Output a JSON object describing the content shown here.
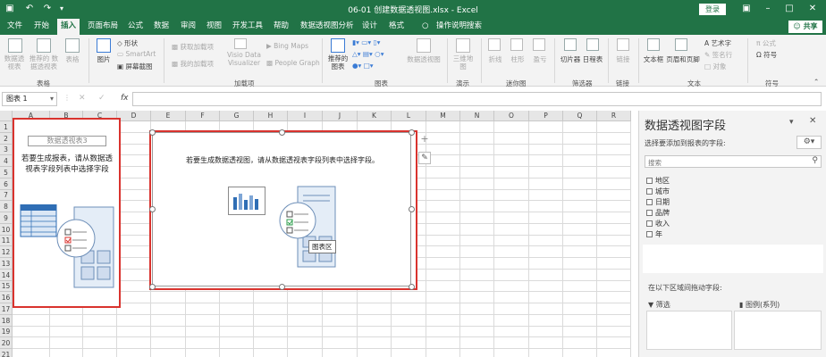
{
  "titlebar": {
    "doc_title": "06-01 创建数据透视图.xlsx - Excel",
    "login": "登录",
    "save_icon": "save-icon",
    "undo_icon": "undo-icon",
    "redo_icon": "redo-icon"
  },
  "tabs": [
    "文件",
    "开始",
    "插入",
    "页面布局",
    "公式",
    "数据",
    "审阅",
    "视图",
    "开发工具",
    "帮助",
    "数据透视图分析",
    "设计",
    "格式"
  ],
  "tellme": "操作说明搜索",
  "share": "共享",
  "ribbon": {
    "groups": {
      "tables": "表格",
      "addins": "加载项",
      "charts": "图表",
      "tours": "演示",
      "sparklines": "迷你图",
      "filters": "筛选器",
      "links": "链接",
      "text": "文本",
      "symbols": "符号"
    },
    "tables": {
      "pivot": "数据透视表",
      "recommended": "推荐的 数据透视表",
      "table": "表格"
    },
    "illustrations": {
      "picture": "图片",
      "shapes": "形状",
      "smartart": "SmartArt",
      "screenshot": "屏幕截图"
    },
    "addins": {
      "get": "获取加载项",
      "my": "我的加载项",
      "visio": "Visio Data Visualizer",
      "bing": "Bing Maps",
      "people": "People Graph"
    },
    "charts": {
      "recommended": "推荐的 图表",
      "pivotchart": "数据透视图"
    },
    "tours": {
      "map3d": "三维地图"
    },
    "sparklines": {
      "line": "折线",
      "column": "柱形",
      "winloss": "盈亏"
    },
    "filters": {
      "slicer": "切片器",
      "timeline": "日程表"
    },
    "links": {
      "link": "链接"
    },
    "text": {
      "textbox": "文本框",
      "headerfooter": "页眉和页脚",
      "wordart": "艺术字",
      "signature": "签名行",
      "object": "对象"
    },
    "symbols": {
      "equation": "公式",
      "symbol": "符号"
    }
  },
  "formula_bar": {
    "name_box": "图表 1",
    "fx": "fx",
    "value": ""
  },
  "grid": {
    "columns": [
      "A",
      "B",
      "C",
      "D",
      "E",
      "F",
      "G",
      "H",
      "I",
      "J",
      "K",
      "L",
      "M",
      "N",
      "O",
      "P",
      "Q",
      "R"
    ],
    "rows": [
      "1",
      "2",
      "3",
      "4",
      "5",
      "6",
      "7",
      "8",
      "9",
      "10",
      "11",
      "12",
      "13",
      "14",
      "15",
      "16",
      "17",
      "18",
      "19",
      "20",
      "21"
    ]
  },
  "pivot_placeholder": {
    "title": "数据透视表3",
    "message": "若要生成报表，请从数据透视表字段列表中选择字段"
  },
  "chart_placeholder": {
    "message": "若要生成数据透视图，请从数据透视表字段列表中选择字段。",
    "tooltip": "图表区"
  },
  "right_panel": {
    "title": "数据透视图字段",
    "subtitle": "选择要添加到报表的字段:",
    "search_placeholder": "搜索",
    "fields": [
      "地区",
      "城市",
      "日期",
      "品牌",
      "收入",
      "年"
    ],
    "drag_hint": "在以下区域间拖动字段:",
    "areas": {
      "filters": "筛选",
      "legend": "图例(系列)"
    }
  }
}
